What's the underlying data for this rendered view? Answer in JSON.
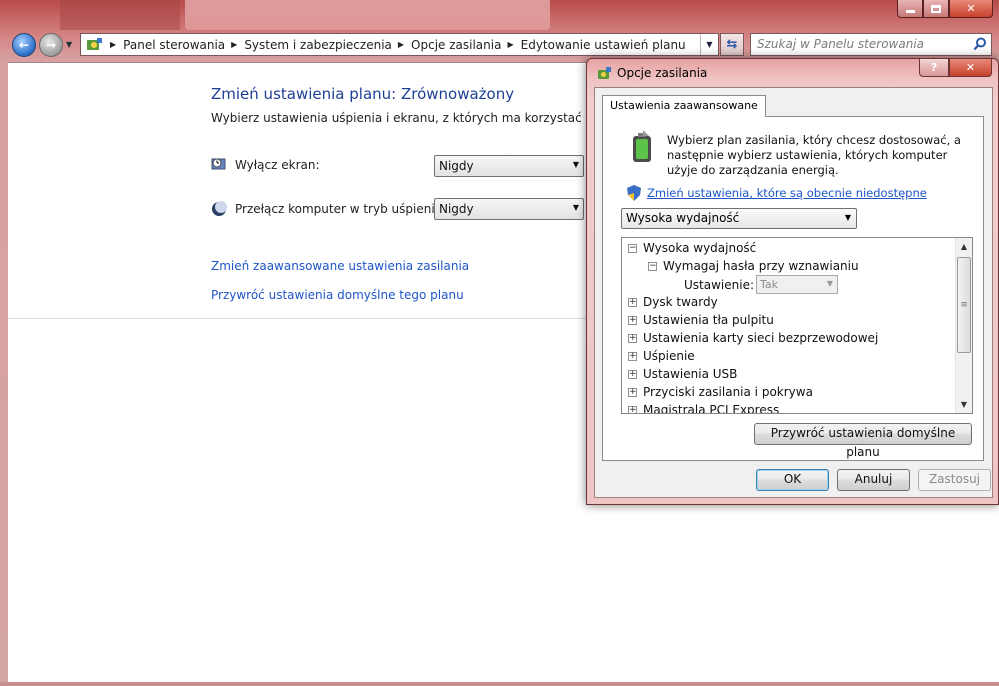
{
  "explorer": {
    "breadcrumbs": [
      "Panel sterowania",
      "System i zabezpieczenia",
      "Opcje zasilania",
      "Edytowanie ustawień planu"
    ],
    "search_placeholder": "Szukaj w Panelu sterowania"
  },
  "plan": {
    "title": "Zmień ustawienia planu: Zrównoważony",
    "subtitle": "Wybierz ustawienia uśpienia i ekranu, z których ma korzystać komputer.",
    "display_off_label": "Wyłącz ekran:",
    "display_off_value": "Nigdy",
    "sleep_label": "Przełącz komputer w tryb uśpienia:",
    "sleep_value": "Nigdy",
    "link_advanced": "Zmień zaawansowane ustawienia zasilania",
    "link_restore": "Przywróć ustawienia domyślne tego planu"
  },
  "dialog": {
    "title": "Opcje zasilania",
    "help": "?",
    "tab": "Ustawienia zaawansowane",
    "intro": "Wybierz plan zasilania, który chcesz dostosować, a następnie wybierz ustawienia, których komputer użyje do zarządzania energią.",
    "shield_link": "Zmień ustawienia, które są obecnie niedostępne",
    "selected_plan": "Wysoka wydajność",
    "tree": {
      "root": "Wysoka wydajność",
      "child": "Wymagaj hasła przy wznawianiu",
      "setting_label": "Ustawienie:",
      "setting_value": "Tak",
      "items": [
        "Dysk twardy",
        "Ustawienia tła pulpitu",
        "Ustawienia karty sieci bezprzewodowej",
        "Uśpienie",
        "Ustawienia USB",
        "Przyciski zasilania i pokrywa",
        "Magistrala PCI Express"
      ]
    },
    "restore_button": "Przywróć ustawienia domyślne planu",
    "ok": "OK",
    "cancel": "Anuluj",
    "apply": "Zastosuj"
  },
  "colors": {
    "link": "#1e56c8",
    "title_blue": "#1e3f94",
    "frame": "#c96b6b"
  }
}
